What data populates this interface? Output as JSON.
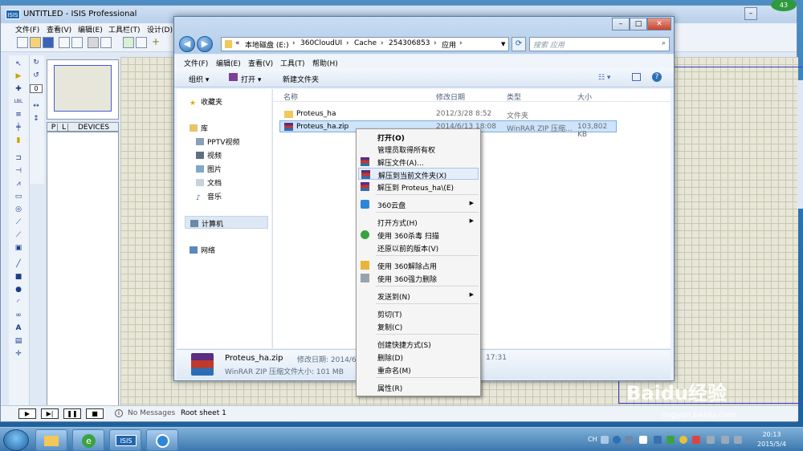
{
  "isis": {
    "title": "UNTITLED - ISIS Professional",
    "logo": "ISIS",
    "menu": [
      "文件(F)",
      "查看(V)",
      "编辑(E)",
      "工具栏(T)",
      "设计(D)"
    ],
    "devtabs": {
      "p": "P",
      "l": "L",
      "devices": "DEVICES"
    },
    "preview_value": "0",
    "status_message": "No Messages",
    "sheet": "Root sheet 1"
  },
  "explorer": {
    "address": [
      "«",
      "本地磁盘 (E:)",
      "›",
      "360CloudUI",
      "›",
      "Cache",
      "›",
      "254306853",
      "›",
      "应用",
      "›"
    ],
    "search_placeholder": "搜索 应用",
    "menu": [
      "文件(F)",
      "编辑(E)",
      "查看(V)",
      "工具(T)",
      "帮助(H)"
    ],
    "commands": {
      "organize": "组织 ▾",
      "open": "打开 ▾",
      "new_folder": "新建文件夹"
    },
    "nav": [
      "收藏夹",
      "库",
      "PPTV视频",
      "视频",
      "图片",
      "文档",
      "音乐",
      "计算机",
      "网络"
    ],
    "columns": [
      "名称",
      "修改日期",
      "类型",
      "大小"
    ],
    "files": [
      {
        "name": "Proteus_ha",
        "date": "2012/3/28 8:52",
        "type": "文件夹",
        "size": ""
      },
      {
        "name": "Proteus_ha.zip",
        "date": "2014/6/13 18:08",
        "type": "WinRAR ZIP 压缩...",
        "size": "103,802 KB"
      }
    ],
    "details": {
      "name": "Proteus_ha.zip",
      "type": "WinRAR ZIP 压缩文件",
      "modified_label": "修改日期: 2014/6/",
      "modified_tail": "17:31",
      "size_label": "大小: 101 MB"
    }
  },
  "context_menu": [
    {
      "label": "打开(O)",
      "bold": true
    },
    {
      "label": "管理员取得所有权"
    },
    {
      "label": "解压文件(A)..."
    },
    {
      "label": "解压到当前文件夹(X)",
      "highlight": true
    },
    {
      "label": "解压到 Proteus_ha\\(E)"
    },
    {
      "label": "360云盘",
      "submenu": true
    },
    {
      "label": "打开方式(H)",
      "submenu": true
    },
    {
      "label": "使用 360杀毒 扫描"
    },
    {
      "label": "还原以前的版本(V)"
    },
    {
      "label": "使用 360解除占用"
    },
    {
      "label": "使用 360强力删除"
    },
    {
      "label": "发送到(N)",
      "submenu": true
    },
    {
      "label": "剪切(T)"
    },
    {
      "label": "复制(C)"
    },
    {
      "label": "创建快捷方式(S)"
    },
    {
      "label": "删除(D)"
    },
    {
      "label": "重命名(M)"
    },
    {
      "label": "属性(R)"
    }
  ],
  "taskbar": {
    "lang": "CH",
    "time": "20:13",
    "date": "2015/5/4",
    "badge": "43",
    "isis_label": "ISIS"
  },
  "watermark": {
    "brand": "Baidu经验",
    "url": "jingyan.baidu.com"
  },
  "colors": {
    "accent": "#2e6fb8",
    "selection": "#cde4fb",
    "grid": "#e8e7d7"
  }
}
